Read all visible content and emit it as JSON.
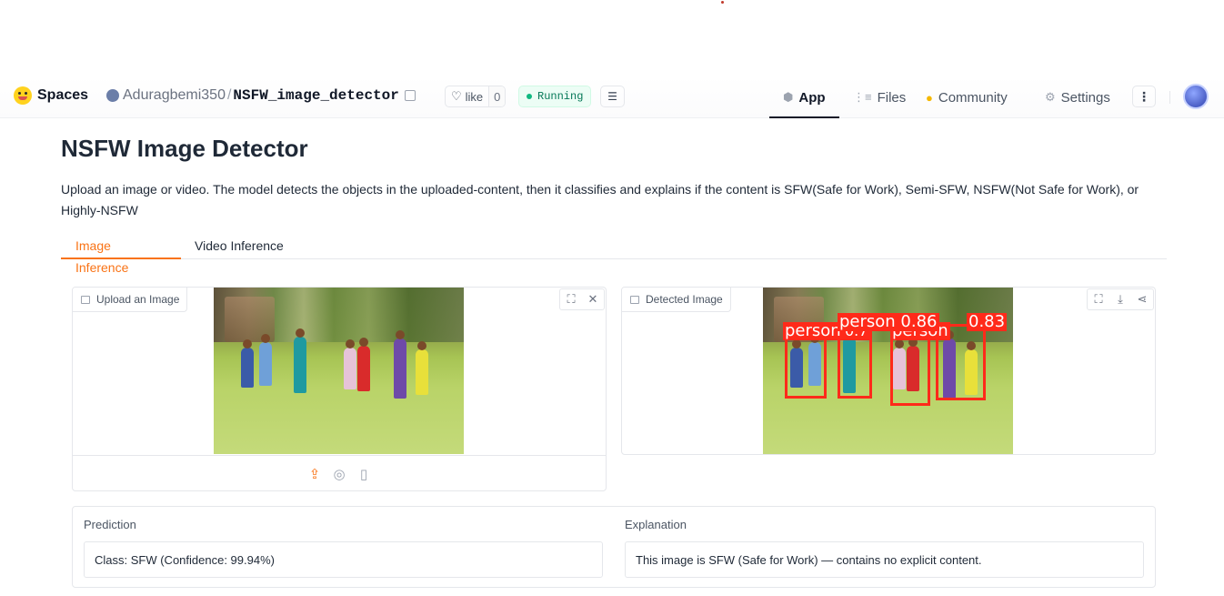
{
  "header": {
    "brand": "Spaces",
    "owner": "Aduragbemi350",
    "separator": "/",
    "repo": "NSFW_image_detector",
    "like_label": "like",
    "like_count": "0",
    "status": "Running",
    "nav": {
      "app": "App",
      "files": "Files",
      "community": "Community",
      "settings": "Settings"
    }
  },
  "page": {
    "title": "NSFW Image Detector",
    "description": "Upload an image or video. The model detects the objects in the uploaded-content, then it classifies and explains if the content is SFW(Safe for Work), Semi-SFW, NSFW(Not Safe for Work), or Highly-NSFW",
    "tabs": [
      "Image Inference",
      "Video Inference"
    ]
  },
  "input_panel": {
    "label": "Upload an Image"
  },
  "output_panel": {
    "label": "Detected Image",
    "detections": [
      "person",
      "person 0.86",
      "0.83",
      "0.7",
      "person"
    ]
  },
  "results": {
    "prediction_label": "Prediction",
    "prediction_value": "Class: SFW (Confidence: 99.94%)",
    "explanation_label": "Explanation",
    "explanation_value": "This image is SFW (Safe for Work) — contains no explicit content."
  },
  "colors": {
    "accent": "#f97316",
    "status_green": "#047857",
    "bbox_red": "#ff2a1a"
  },
  "icons": [
    "hugging-face-logo",
    "copy-icon",
    "heart-icon",
    "logs-icon",
    "app-icon",
    "files-icon",
    "community-icon",
    "settings-icon",
    "more-icon",
    "image-icon",
    "fullscreen-icon",
    "close-icon",
    "download-icon",
    "share-icon",
    "upload-icon",
    "webcam-icon",
    "clipboard-icon"
  ]
}
